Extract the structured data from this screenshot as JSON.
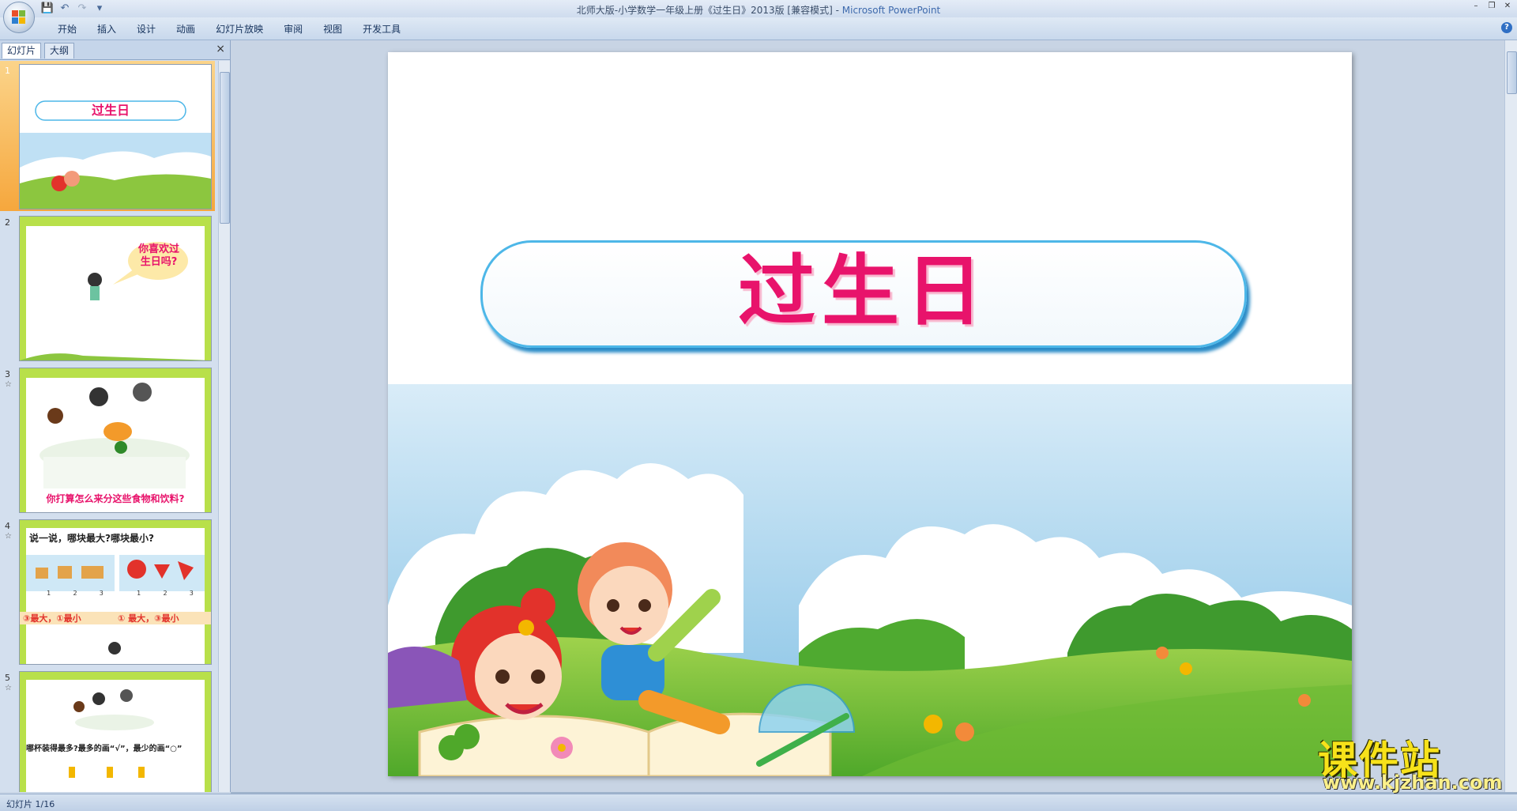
{
  "titlebar": {
    "title": "北师大版-小学数学一年级上册《过生日》2013版 [兼容模式] - ",
    "app_name": "Microsoft PowerPoint",
    "qat_icons": [
      "save-icon",
      "undo-icon",
      "redo-icon",
      "customize-icon"
    ],
    "window_buttons": [
      "minimize",
      "restore",
      "close"
    ]
  },
  "menu": {
    "items": [
      "开始",
      "插入",
      "设计",
      "动画",
      "幻灯片放映",
      "审阅",
      "视图",
      "开发工具"
    ]
  },
  "panel": {
    "tabs": [
      "幻灯片",
      "大纲"
    ],
    "close_label": "×",
    "slides": [
      {
        "number": "1",
        "title": "过生日"
      },
      {
        "number": "2",
        "bubble_line1": "你喜欢过",
        "bubble_line2": "生日吗?"
      },
      {
        "number": "3",
        "caption": "你打算怎么来分这些食物和饮料?"
      },
      {
        "number": "4",
        "question": "说一说，哪块最大?哪块最小?",
        "answer_left": "③最大，①最小",
        "answer_right": "① 最大，③最小",
        "labels_left": [
          "1",
          "2",
          "3"
        ],
        "labels_right": [
          "1",
          "2",
          "3"
        ]
      },
      {
        "number": "5",
        "caption": "哪杯装得最多?最多的画“√”，最少的画“○”"
      }
    ]
  },
  "slide": {
    "title": "过生日"
  },
  "status": {
    "slide_counter": "幻灯片 1/16"
  },
  "watermark": {
    "text": "课件站",
    "url": "www.kjzhan.com"
  },
  "colors": {
    "title_pink": "#e8136b",
    "title_border": "#4db7e8",
    "grass": "#8cc63f",
    "sky": "#bfe0f4"
  }
}
